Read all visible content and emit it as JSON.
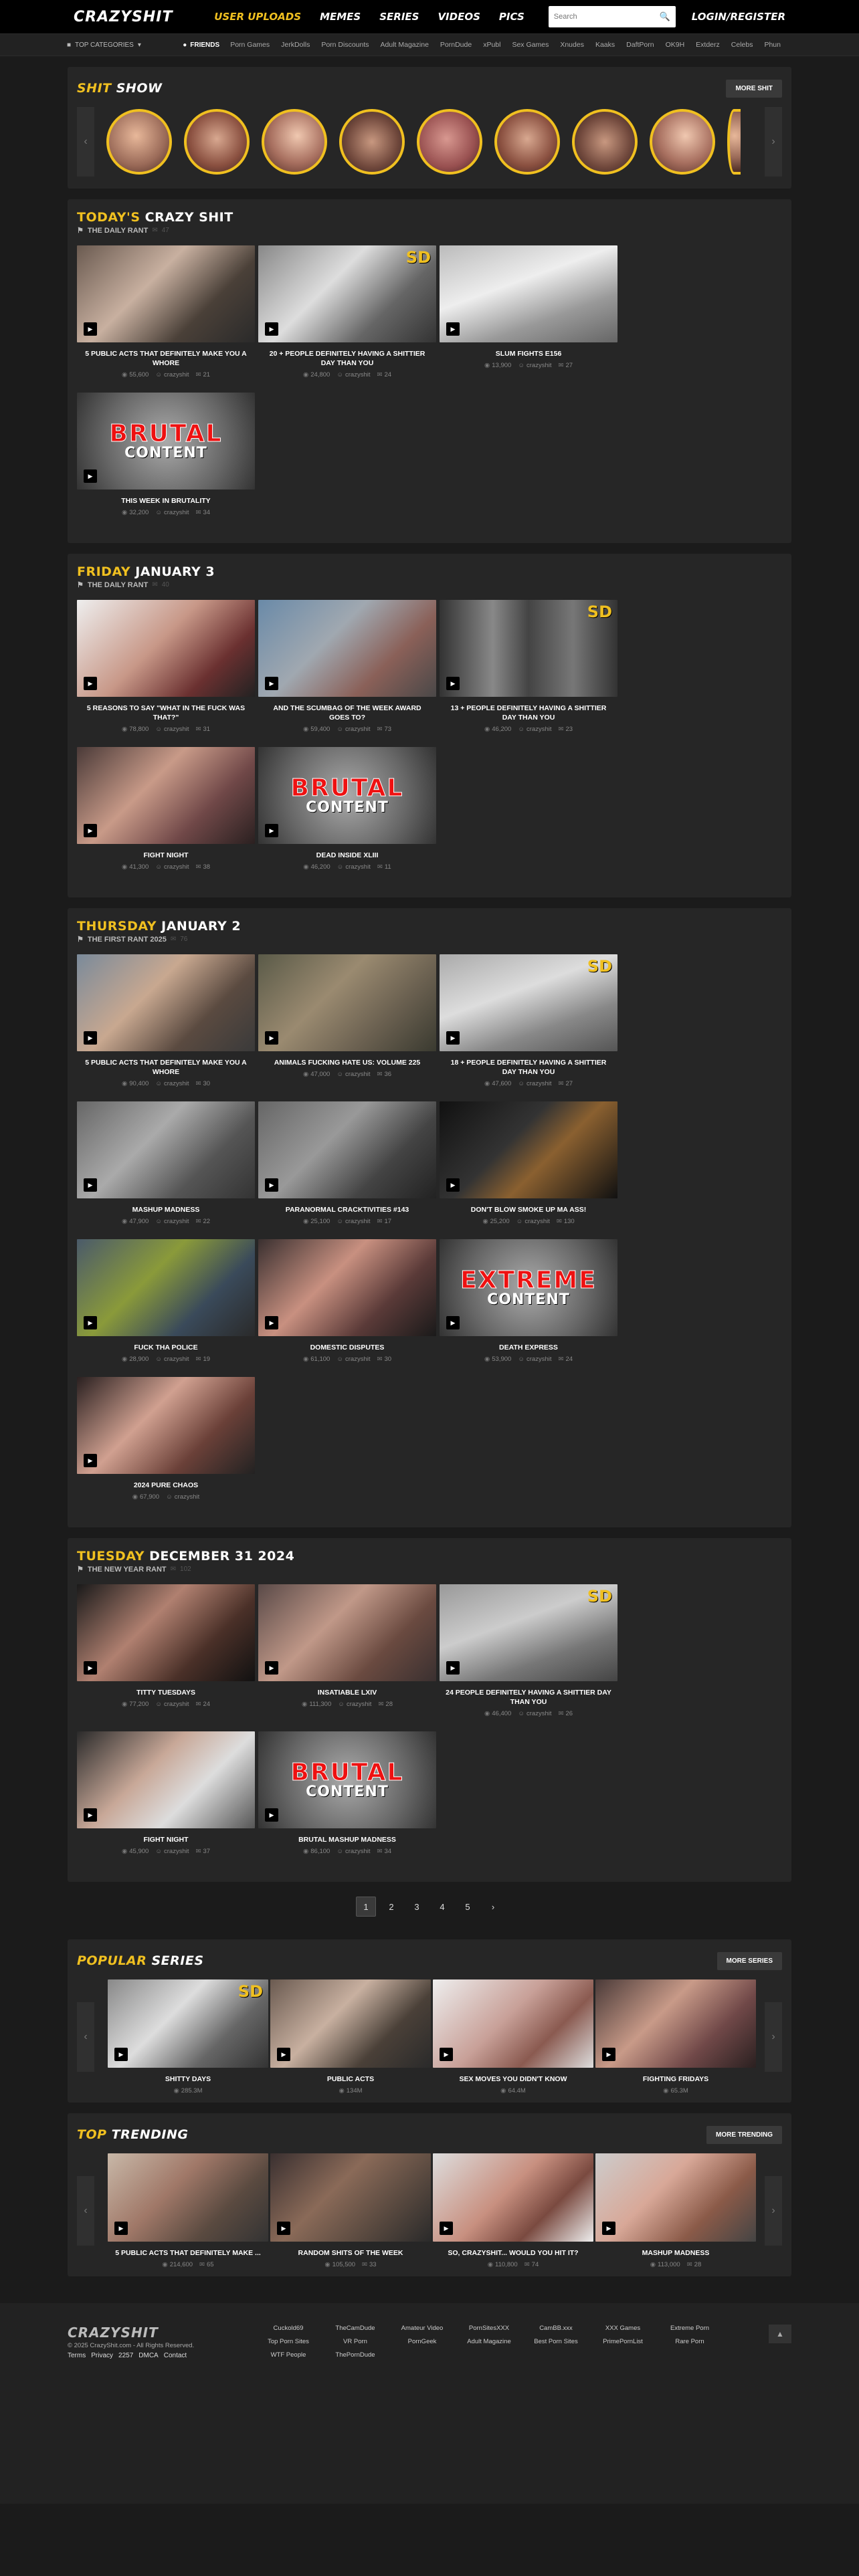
{
  "header": {
    "logo": "CRAZYSHIT",
    "nav": [
      "USER UPLOADS",
      "MEMES",
      "SERIES",
      "VIDEOS",
      "PICS"
    ],
    "search_placeholder": "Search",
    "login": "LOGIN/REGISTER"
  },
  "subbar": {
    "categories": "TOP CATEGORIES",
    "friends": "FRIENDS",
    "links": [
      "Porn Games",
      "JerkDolls",
      "Porn Discounts",
      "Adult Magazine",
      "PornDude",
      "xPubl",
      "Sex Games",
      "Xnudes",
      "Kaaks",
      "DaftPorn",
      "OK9H",
      "Extderz",
      "Celebs",
      "Phun"
    ]
  },
  "shitshow": {
    "title_a": "SHIT",
    "title_b": "SHOW",
    "more": "MORE SHIT"
  },
  "sections": [
    {
      "day": "TODAY'S",
      "date": "CRAZY SHIT",
      "sub": "THE DAILY RANT",
      "count": "47",
      "cards": [
        {
          "title": "5 PUBLIC ACTS THAT DEFINITELY MAKE YOU A WHORE",
          "views": "55,600",
          "user": "crazyshit",
          "comments": "21",
          "style": "t1",
          "sd": false,
          "brutal": ""
        },
        {
          "title": "20 + PEOPLE DEFINITELY HAVING A SHITTIER DAY THAN YOU",
          "views": "24,800",
          "user": "crazyshit",
          "comments": "24",
          "style": "t2",
          "sd": true,
          "brutal": ""
        },
        {
          "title": "SLUM FIGHTS E156",
          "views": "13,900",
          "user": "crazyshit",
          "comments": "27",
          "style": "t3",
          "sd": false,
          "brutal": ""
        },
        {
          "title": "THIS WEEK IN BRUTALITY",
          "views": "32,200",
          "user": "crazyshit",
          "comments": "34",
          "style": "tb",
          "sd": false,
          "brutal": "BRUTAL"
        }
      ]
    },
    {
      "day": "FRIDAY",
      "date": "JANUARY 3",
      "sub": "THE DAILY RANT",
      "count": "40",
      "cards": [
        {
          "title": "5 REASONS TO SAY \"WHAT IN THE FUCK WAS THAT?\"",
          "views": "78,800",
          "user": "crazyshit",
          "comments": "31",
          "style": "t4",
          "sd": false,
          "brutal": ""
        },
        {
          "title": "AND THE SCUMBAG OF THE WEEK AWARD GOES TO?",
          "views": "59,400",
          "user": "crazyshit",
          "comments": "73",
          "style": "t5",
          "sd": false,
          "brutal": ""
        },
        {
          "title": "13 + PEOPLE DEFINITELY HAVING A SHITTIER DAY THAN YOU",
          "views": "46,200",
          "user": "crazyshit",
          "comments": "23",
          "style": "t6",
          "sd": true,
          "brutal": ""
        },
        {
          "title": "FIGHT NIGHT",
          "views": "41,300",
          "user": "crazyshit",
          "comments": "38",
          "style": "t7",
          "sd": false,
          "brutal": ""
        },
        {
          "title": "DEAD INSIDE XLIII",
          "views": "46,200",
          "user": "crazyshit",
          "comments": "11",
          "style": "tb",
          "sd": false,
          "brutal": "BRUTAL"
        }
      ]
    },
    {
      "day": "THURSDAY",
      "date": "JANUARY 2",
      "sub": "THE FIRST RANT 2025",
      "count": "76",
      "cards": [
        {
          "title": "5 PUBLIC ACTS THAT DEFINITELY MAKE YOU A WHORE",
          "views": "90,400",
          "user": "crazyshit",
          "comments": "30",
          "style": "t8",
          "sd": false,
          "brutal": ""
        },
        {
          "title": "ANIMALS FUCKING HATE US: VOLUME 225",
          "views": "47,000",
          "user": "crazyshit",
          "comments": "36",
          "style": "t9",
          "sd": false,
          "brutal": ""
        },
        {
          "title": "18 + PEOPLE DEFINITELY HAVING A SHITTIER DAY THAN YOU",
          "views": "47,600",
          "user": "crazyshit",
          "comments": "27",
          "style": "t10",
          "sd": true,
          "brutal": ""
        },
        {
          "title": "MASHUP MADNESS",
          "views": "47,900",
          "user": "crazyshit",
          "comments": "22",
          "style": "t11",
          "sd": false,
          "brutal": ""
        },
        {
          "title": "PARANORMAL CRACKTIVITIES #143",
          "views": "25,100",
          "user": "crazyshit",
          "comments": "17",
          "style": "t12",
          "sd": false,
          "brutal": ""
        },
        {
          "title": "DON'T BLOW SMOKE UP MA ASS!",
          "views": "25,200",
          "user": "crazyshit",
          "comments": "130",
          "style": "t13",
          "sd": false,
          "brutal": ""
        },
        {
          "title": "FUCK THA POLICE",
          "views": "28,900",
          "user": "crazyshit",
          "comments": "19",
          "style": "t14",
          "sd": false,
          "brutal": ""
        },
        {
          "title": "DOMESTIC DISPUTES",
          "views": "61,100",
          "user": "crazyshit",
          "comments": "30",
          "style": "t15",
          "sd": false,
          "brutal": ""
        },
        {
          "title": "DEATH EXPRESS",
          "views": "53,900",
          "user": "crazyshit",
          "comments": "24",
          "style": "tb",
          "sd": false,
          "brutal": "EXTREME"
        },
        {
          "title": "2024 PURE CHAOS",
          "views": "67,900",
          "user": "crazyshit",
          "comments": "",
          "style": "t16",
          "sd": false,
          "brutal": ""
        }
      ]
    },
    {
      "day": "TUESDAY",
      "date": "DECEMBER 31 2024",
      "sub": "THE NEW YEAR RANT",
      "count": "102",
      "cards": [
        {
          "title": "TITTY TUESDAYS",
          "views": "77,200",
          "user": "crazyshit",
          "comments": "24",
          "style": "t17",
          "sd": false,
          "brutal": ""
        },
        {
          "title": "INSATIABLE LXIV",
          "views": "111,300",
          "user": "crazyshit",
          "comments": "28",
          "style": "t18",
          "sd": false,
          "brutal": ""
        },
        {
          "title": "24 PEOPLE DEFINITELY HAVING A SHITTIER DAY THAN YOU",
          "views": "46,400",
          "user": "crazyshit",
          "comments": "26",
          "style": "t19",
          "sd": true,
          "brutal": ""
        },
        {
          "title": "FIGHT NIGHT",
          "views": "45,900",
          "user": "crazyshit",
          "comments": "37",
          "style": "t20",
          "sd": false,
          "brutal": ""
        },
        {
          "title": "BRUTAL MASHUP MADNESS",
          "views": "86,100",
          "user": "crazyshit",
          "comments": "34",
          "style": "tb",
          "sd": false,
          "brutal": "BRUTAL"
        }
      ]
    }
  ],
  "pagination": [
    "1",
    "2",
    "3",
    "4",
    "5",
    "›"
  ],
  "popular": {
    "title_a": "POPULAR",
    "title_b": "SERIES",
    "more": "MORE SERIES",
    "cards": [
      {
        "title": "SHITTY DAYS",
        "views": "285.3M",
        "style": "t2",
        "sd": true
      },
      {
        "title": "PUBLIC ACTS",
        "views": "134M",
        "style": "t1",
        "sd": false
      },
      {
        "title": "SEX MOVES YOU DIDN'T KNOW",
        "views": "64.4M",
        "style": "t21",
        "sd": false
      },
      {
        "title": "FIGHTING FRIDAYS",
        "views": "65.3M",
        "style": "t7",
        "sd": false
      }
    ]
  },
  "trending": {
    "title_a": "TOP",
    "title_b": "TRENDING",
    "more": "MORE TRENDING",
    "cards": [
      {
        "title": "5 PUBLIC ACTS THAT DEFINITELY MAKE ...",
        "views": "214,600",
        "comments": "65",
        "style": "t22"
      },
      {
        "title": "RANDOM SHITS OF THE WEEK",
        "views": "105,500",
        "comments": "33",
        "style": "t23"
      },
      {
        "title": "SO, CRAZYSHIT... WOULD YOU HIT IT?",
        "views": "110,800",
        "comments": "74",
        "style": "t24"
      },
      {
        "title": "MASHUP MADNESS",
        "views": "113,000",
        "comments": "28",
        "style": "t25"
      }
    ]
  },
  "footer": {
    "logo": "CRAZYSHIT",
    "copyright": "© 2025 CrazyShit.com - All Rights Reserved.",
    "links": [
      "Terms",
      "Privacy",
      "2257",
      "DMCA",
      "Contact"
    ],
    "partners": [
      "Cuckold69",
      "TheCamDude",
      "Amateur Video",
      "PornSitesXXX",
      "CamBB.xxx",
      "XXX Games",
      "Extreme Porn",
      "Top Porn Sites",
      "VR Porn",
      "PornGeek",
      "Adult Magazine",
      "Best Porn Sites",
      "PrimePornList",
      "Rare Porn",
      "WTF People",
      "ThePornDude"
    ]
  }
}
